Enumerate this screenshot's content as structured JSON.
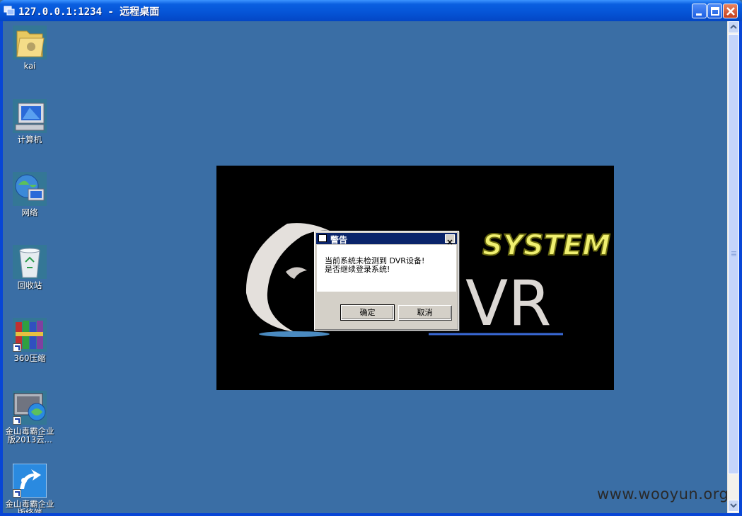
{
  "window": {
    "title": "127.0.0.1:1234 - 远程桌面"
  },
  "desktop_icons": [
    {
      "label": "kai",
      "icon": "folder-icon"
    },
    {
      "label": "计算机",
      "icon": "computer-icon"
    },
    {
      "label": "网络",
      "icon": "network-icon"
    },
    {
      "label": "回收站",
      "icon": "recycle-bin-icon"
    },
    {
      "label": "360压缩",
      "icon": "archive-icon"
    },
    {
      "label": "金山毒霸企业版2013云...",
      "icon": "antivirus-icon"
    },
    {
      "label": "金山毒霸企业版终端",
      "icon": "antivirus-terminal-icon"
    }
  ],
  "splash": {
    "logo_text": "SYSTEM",
    "logo_big": "VR"
  },
  "dialog": {
    "title": "警告",
    "line1": "当前系统未检测到 DVR设备!",
    "line2": "是否继续登录系统!",
    "ok_label": "确定",
    "cancel_label": "取消"
  },
  "watermark": "www.wooyun.org"
}
